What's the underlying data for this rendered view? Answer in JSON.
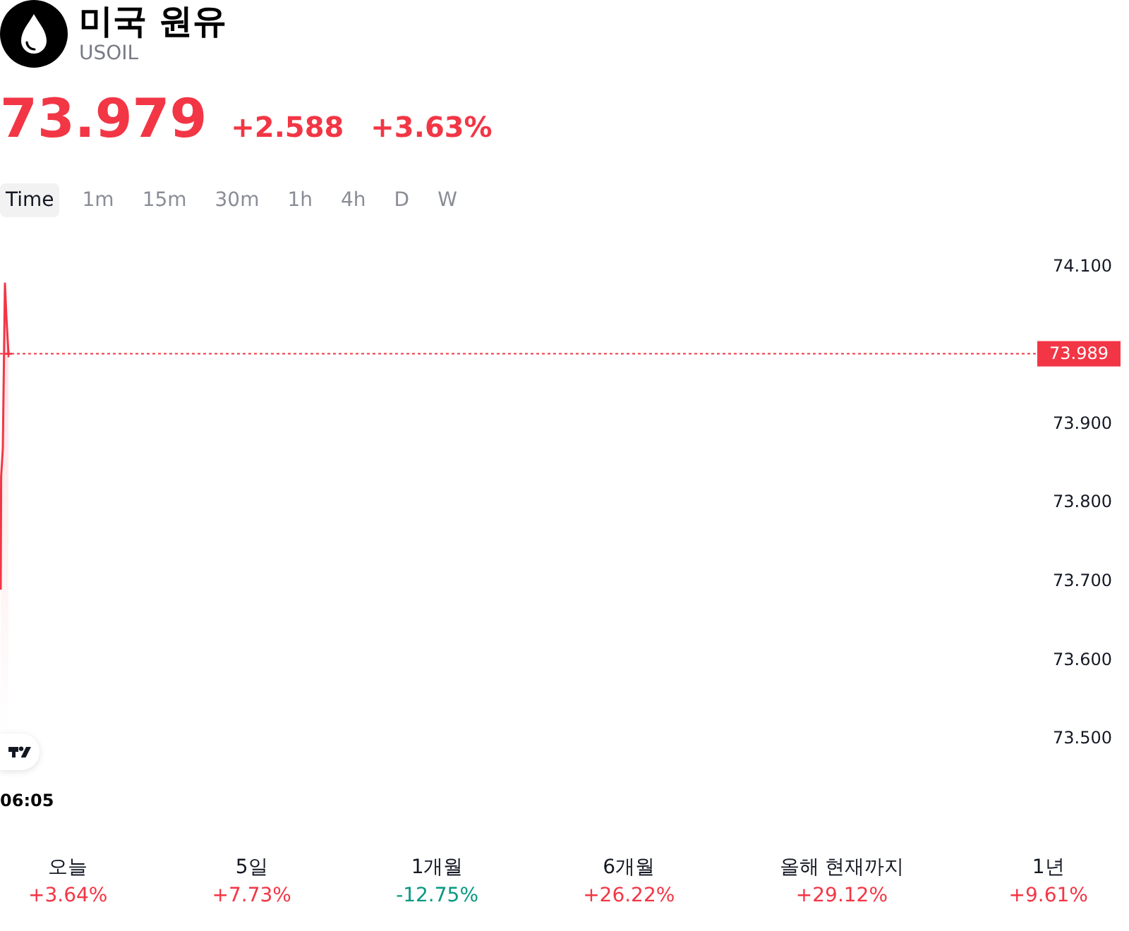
{
  "instrument": {
    "name": "미국 원유",
    "symbol": "USOIL"
  },
  "quote": {
    "price": "73.979",
    "change": "+2.588",
    "change_percent": "+3.63%"
  },
  "intervals": [
    {
      "label": "Time",
      "selected": true
    },
    {
      "label": "1m",
      "selected": false
    },
    {
      "label": "15m",
      "selected": false
    },
    {
      "label": "30m",
      "selected": false
    },
    {
      "label": "1h",
      "selected": false
    },
    {
      "label": "4h",
      "selected": false
    },
    {
      "label": "D",
      "selected": false
    },
    {
      "label": "W",
      "selected": false
    }
  ],
  "chart": {
    "price_scale": [
      {
        "kind": "label",
        "text": "74.100"
      },
      {
        "kind": "price_tag",
        "text": "73.989"
      },
      {
        "kind": "label",
        "text": "73.900"
      },
      {
        "kind": "label",
        "text": "73.800"
      },
      {
        "kind": "label",
        "text": "73.700"
      },
      {
        "kind": "label",
        "text": "73.600"
      },
      {
        "kind": "label",
        "text": "73.500"
      }
    ],
    "time_label": "06:05"
  },
  "performance": [
    {
      "period": "오늘",
      "change": "+3.64%",
      "color": "#f23645"
    },
    {
      "period": "5일",
      "change": "+7.73%",
      "color": "#f23645"
    },
    {
      "period": "1개월",
      "change": "-12.75%",
      "color": "#089981"
    },
    {
      "period": "6개월",
      "change": "+26.22%",
      "color": "#f23645"
    },
    {
      "period": "올해 현재까지",
      "change": "+29.12%",
      "color": "#f23645"
    },
    {
      "period": "1년",
      "change": "+9.61%",
      "color": "#f23645"
    }
  ]
}
